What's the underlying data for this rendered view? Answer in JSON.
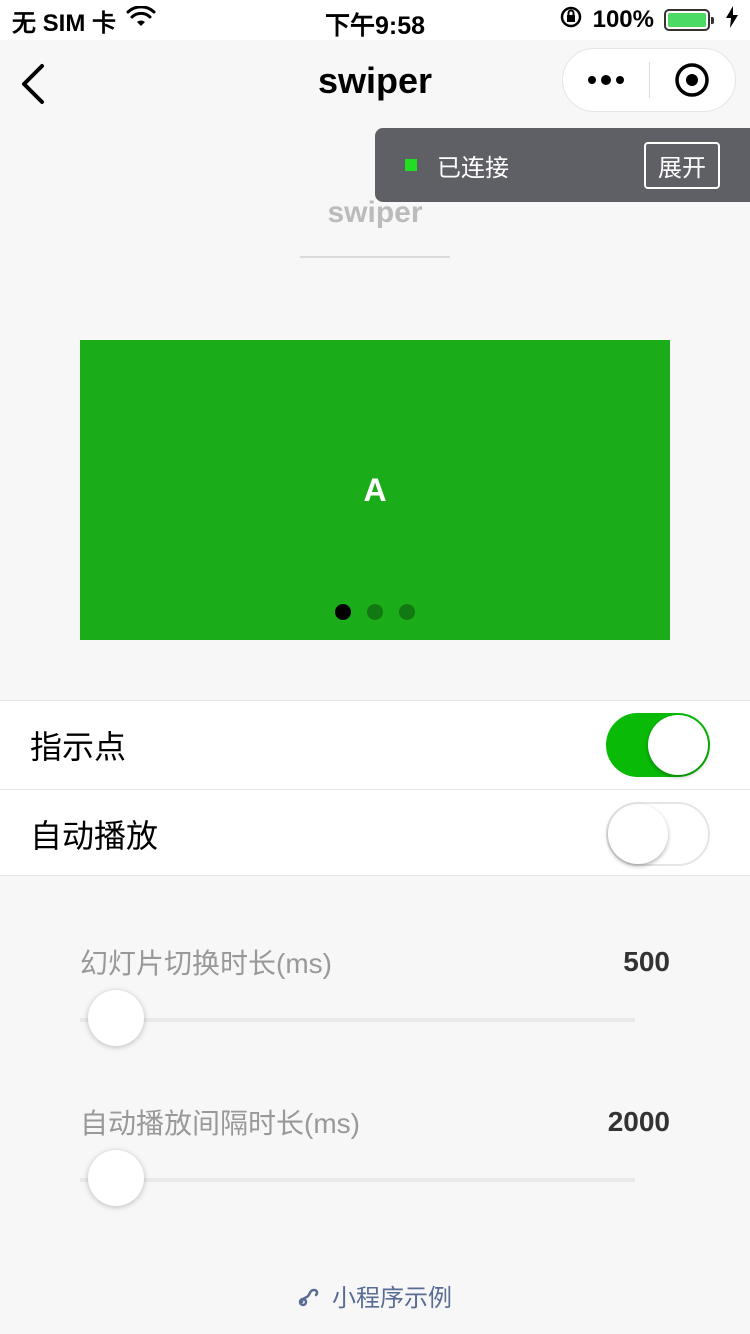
{
  "status_bar": {
    "carrier": "无 SIM 卡",
    "time": "下午9:58",
    "battery_pct": "100%",
    "icons": [
      "wifi-icon",
      "orientation-lock-icon",
      "battery-icon",
      "charging-icon"
    ]
  },
  "nav": {
    "title": "swiper",
    "back_icon": "chevron-left-icon",
    "menu_icon": "more-dots-icon",
    "close_icon": "target-icon"
  },
  "debug": {
    "status": "已连接",
    "expand_label": "展开",
    "status_color": "#22dd22"
  },
  "page": {
    "title": "swiper"
  },
  "swiper": {
    "current_slide": "A",
    "slide_color": "#1aad19",
    "dot_count": 3,
    "active_dot": 0
  },
  "settings": [
    {
      "label": "指示点",
      "on": true
    },
    {
      "label": "自动播放",
      "on": false
    }
  ],
  "sliders": [
    {
      "label": "幻灯片切换时长(ms)",
      "value": "500"
    },
    {
      "label": "自动播放间隔时长(ms)",
      "value": "2000"
    }
  ],
  "footer": {
    "text": "小程序示例",
    "icon": "mini-program-icon"
  },
  "colors": {
    "accent_green": "#09bb07",
    "link_blue": "#586c94"
  }
}
